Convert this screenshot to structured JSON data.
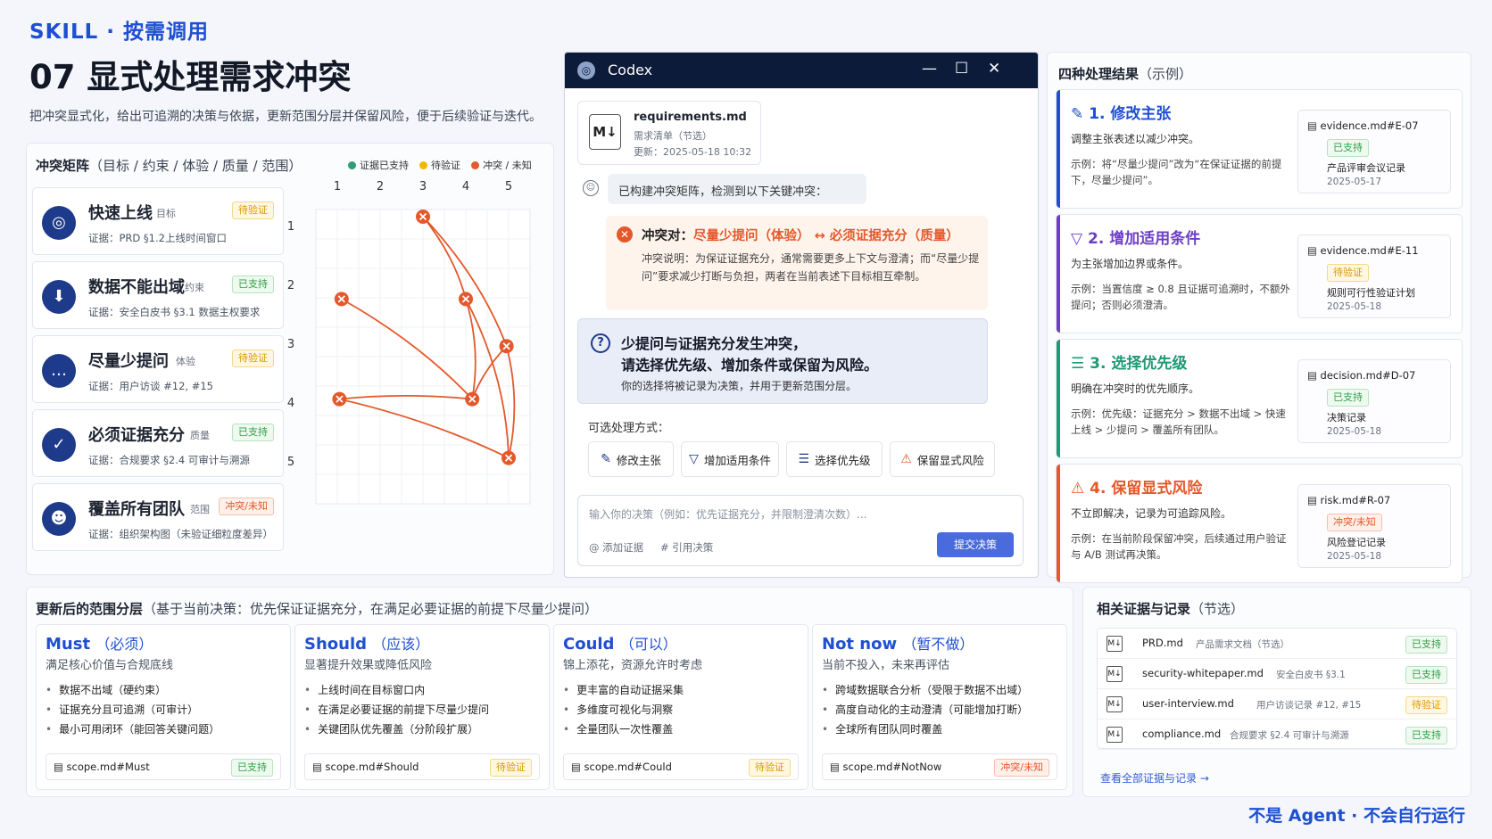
{
  "header": {
    "kicker": "SKILL · 按需调用",
    "title": "07 显式处理需求冲突",
    "subtitle": "把冲突显式化，给出可追溯的决策与依据，更新范围分层并保留风险，便于后续验证与迭代。"
  },
  "matrix": {
    "title": "冲突矩阵",
    "title_paren": "（目标 / 约束 / 体验 / 质量 / 范围）",
    "legend": [
      "证据已支持",
      "待验证",
      "冲突 / 未知"
    ],
    "legend_colors": [
      "#2f9e6e",
      "#f2b800",
      "#e4582b"
    ],
    "col_labels": [
      "1",
      "2",
      "3",
      "4",
      "5"
    ],
    "row_labels": [
      "1",
      "2",
      "3",
      "4",
      "5"
    ],
    "nodes": [
      {
        "col": 3.0,
        "row": 1.0
      },
      {
        "col": 1.1,
        "row": 2.4
      },
      {
        "col": 4.0,
        "row": 2.4
      },
      {
        "col": 4.95,
        "row": 3.2
      },
      {
        "col": 1.05,
        "row": 4.1
      },
      {
        "col": 4.15,
        "row": 4.1
      },
      {
        "col": 5.0,
        "row": 5.1
      }
    ],
    "edges": [
      [
        0,
        2
      ],
      [
        2,
        5
      ],
      [
        0,
        3
      ],
      [
        3,
        6
      ],
      [
        1,
        5
      ],
      [
        4,
        5
      ],
      [
        4,
        6
      ],
      [
        5,
        3
      ],
      [
        2,
        6
      ]
    ],
    "requirements": [
      {
        "icon": "target-icon",
        "glyph": "◎",
        "name": "快速上线",
        "type": "目标",
        "status": "待验证",
        "status_kind": "wait",
        "evidence": "证据：PRD §1.2上线时间窗口"
      },
      {
        "icon": "shield-icon",
        "glyph": "⬇",
        "name": "数据不能出域",
        "type": "约束",
        "status": "已支持",
        "status_kind": "ok",
        "evidence": "证据：安全白皮书 §3.1 数据主权要求"
      },
      {
        "icon": "chat-icon",
        "glyph": "…",
        "name": "尽量少提问",
        "type": "体验",
        "status": "待验证",
        "status_kind": "wait",
        "evidence": "证据：用户访谈 #12, #15"
      },
      {
        "icon": "check-icon",
        "glyph": "✓",
        "name": "必须证据充分",
        "type": "质量",
        "status": "已支持",
        "status_kind": "ok",
        "evidence": "证据：合规要求 §2.4 可审计与溯源"
      },
      {
        "icon": "team-icon",
        "glyph": "☻",
        "name": "覆盖所有团队",
        "type": "范围",
        "status": "冲突/未知",
        "status_kind": "bad",
        "evidence": "证据：组织架构图（未验证细粒度差异）"
      }
    ]
  },
  "codex": {
    "title": "Codex",
    "file": {
      "name": "requirements.md",
      "desc": "需求清单（节选）",
      "updated": "更新：2025-05-18 10:32",
      "icon_text": "M↓"
    },
    "bot_message": "已构建冲突矩阵，检测到以下关键冲突：",
    "conflict": {
      "label": "冲突对：",
      "a": "尽量少提问（体验）",
      "arrow": "↔",
      "b": "必须证据充分（质量）",
      "desc": "冲突说明：为保证证据充分，通常需要更多上下文与澄清；而“尽量少提问”要求减少打断与负担，两者在当前表述下目标相互牵制。"
    },
    "question": {
      "line1": "少提问与证据充分发生冲突，",
      "line2": "请选择优先级、增加条件或保留为风险。",
      "note": "你的选择将被记录为决策，并用于更新范围分层。"
    },
    "options_label": "可选处理方式：",
    "options": [
      {
        "icon": "pencil-icon",
        "glyph": "✎",
        "label": "修改主张"
      },
      {
        "icon": "filter-icon",
        "glyph": "▽",
        "label": "增加适用条件"
      },
      {
        "icon": "list-icon",
        "glyph": "☰",
        "label": "选择优先级"
      },
      {
        "icon": "warning-icon",
        "glyph": "⚠",
        "label": "保留显式风险"
      }
    ],
    "input_placeholder": "输入你的决策（例如：优先证据充分，并限制澄清次数）...",
    "add_evidence": "添加证据",
    "quote_decision": "引用决策",
    "submit": "提交决策"
  },
  "outcomes": {
    "title": "四种处理结果",
    "title_paren": "（示例）",
    "cards": [
      {
        "icon": "pencil-icon",
        "glyph": "✎",
        "title": "1. 修改主张",
        "color": "#1f4fd1",
        "desc": "调整主张表述以减少冲突。",
        "example": "示例：将“尽量少提问”改为“在保证证据的前提下，尽量少提问”。",
        "ref": "evidence.md#E-07",
        "tag": "已支持",
        "tag_kind": "ok",
        "ref_desc": "产品评审会议记录",
        "date": "2025-05-17"
      },
      {
        "icon": "filter-icon",
        "glyph": "▽",
        "title": "2. 增加适用条件",
        "color": "#6d3fc4",
        "desc": "为主张增加边界或条件。",
        "example": "示例：当置信度 ≥ 0.8 且证据可追溯时，不额外提问；否则必须澄清。",
        "ref": "evidence.md#E-11",
        "tag": "待验证",
        "tag_kind": "wait",
        "ref_desc": "规则可行性验证计划",
        "date": "2025-05-18"
      },
      {
        "icon": "list-icon",
        "glyph": "☰",
        "title": "3. 选择优先级",
        "color": "#1f9a74",
        "desc": "明确在冲突时的优先顺序。",
        "example": "示例：优先级：证据充分 > 数据不出域 > 快速上线 > 少提问 > 覆盖所有团队。",
        "ref": "decision.md#D-07",
        "tag": "已支持",
        "tag_kind": "ok",
        "ref_desc": "决策记录",
        "date": "2025-05-18"
      },
      {
        "icon": "warning-icon",
        "glyph": "⚠",
        "title": "4. 保留显式风险",
        "color": "#e4582b",
        "desc": "不立即解决，记录为可追踪风险。",
        "example": "示例：在当前阶段保留冲突，后续通过用户验证与 A/B 测试再决策。",
        "ref": "risk.md#R-07",
        "tag": "冲突/未知",
        "tag_kind": "bad",
        "ref_desc": "风险登记记录",
        "date": "2025-05-18"
      }
    ]
  },
  "scope": {
    "title": "更新后的范围分层",
    "title_paren": "（基于当前决策：优先保证证据充分，在满足必要证据的前提下尽量少提问）",
    "tiers": [
      {
        "name": "Must",
        "paren": "（必须）",
        "desc": "满足核心价值与合规底线",
        "items": [
          "数据不出域（硬约束）",
          "证据充分且可追溯（可审计）",
          "最小可用闭环（能回答关键问题）"
        ],
        "file": "scope.md#Must",
        "tag": "已支持",
        "tag_kind": "ok"
      },
      {
        "name": "Should",
        "paren": "（应该）",
        "desc": "显著提升效果或降低风险",
        "items": [
          "上线时间在目标窗口内",
          "在满足必要证据的前提下尽量少提问",
          "关键团队优先覆盖（分阶段扩展）"
        ],
        "file": "scope.md#Should",
        "tag": "待验证",
        "tag_kind": "wait"
      },
      {
        "name": "Could",
        "paren": "（可以）",
        "desc": "锦上添花，资源允许时考虑",
        "items": [
          "更丰富的自动证据采集",
          "多维度可视化与洞察",
          "全量团队一次性覆盖"
        ],
        "file": "scope.md#Could",
        "tag": "待验证",
        "tag_kind": "wait"
      },
      {
        "name": "Not now",
        "paren": "（暂不做）",
        "desc": "当前不投入，未来再评估",
        "items": [
          "跨域数据联合分析（受限于数据不出域）",
          "高度自动化的主动澄清（可能增加打断）",
          "全球所有团队同时覆盖"
        ],
        "file": "scope.md#NotNow",
        "tag": "冲突/未知",
        "tag_kind": "bad"
      }
    ]
  },
  "evidence": {
    "title": "相关证据与记录",
    "title_paren": "（节选）",
    "rows": [
      {
        "file": "PRD.md",
        "desc": "产品需求文档（节选）",
        "tag": "已支持",
        "tag_kind": "ok"
      },
      {
        "file": "security-whitepaper.md",
        "desc": "安全白皮书 §3.1",
        "tag": "已支持",
        "tag_kind": "ok"
      },
      {
        "file": "user-interview.md",
        "desc": "用户访谈记录 #12, #15",
        "tag": "待验证",
        "tag_kind": "wait"
      },
      {
        "file": "compliance.md",
        "desc": "合规要求 §2.4 可审计与溯源",
        "tag": "已支持",
        "tag_kind": "ok"
      }
    ],
    "link": "查看全部证据与记录 →"
  },
  "footer": "不是 Agent · 不会自行运行"
}
